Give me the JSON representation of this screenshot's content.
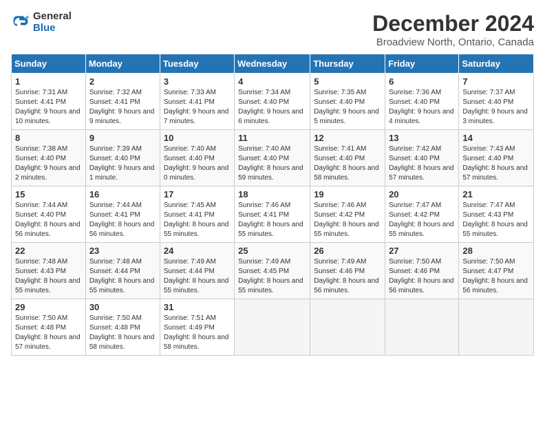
{
  "header": {
    "logo_general": "General",
    "logo_blue": "Blue",
    "title": "December 2024",
    "location": "Broadview North, Ontario, Canada"
  },
  "columns": [
    "Sunday",
    "Monday",
    "Tuesday",
    "Wednesday",
    "Thursday",
    "Friday",
    "Saturday"
  ],
  "weeks": [
    [
      {
        "day": "1",
        "info": "Sunrise: 7:31 AM\nSunset: 4:41 PM\nDaylight: 9 hours and 10 minutes."
      },
      {
        "day": "2",
        "info": "Sunrise: 7:32 AM\nSunset: 4:41 PM\nDaylight: 9 hours and 9 minutes."
      },
      {
        "day": "3",
        "info": "Sunrise: 7:33 AM\nSunset: 4:41 PM\nDaylight: 9 hours and 7 minutes."
      },
      {
        "day": "4",
        "info": "Sunrise: 7:34 AM\nSunset: 4:40 PM\nDaylight: 9 hours and 6 minutes."
      },
      {
        "day": "5",
        "info": "Sunrise: 7:35 AM\nSunset: 4:40 PM\nDaylight: 9 hours and 5 minutes."
      },
      {
        "day": "6",
        "info": "Sunrise: 7:36 AM\nSunset: 4:40 PM\nDaylight: 9 hours and 4 minutes."
      },
      {
        "day": "7",
        "info": "Sunrise: 7:37 AM\nSunset: 4:40 PM\nDaylight: 9 hours and 3 minutes."
      }
    ],
    [
      {
        "day": "8",
        "info": "Sunrise: 7:38 AM\nSunset: 4:40 PM\nDaylight: 9 hours and 2 minutes."
      },
      {
        "day": "9",
        "info": "Sunrise: 7:39 AM\nSunset: 4:40 PM\nDaylight: 9 hours and 1 minute."
      },
      {
        "day": "10",
        "info": "Sunrise: 7:40 AM\nSunset: 4:40 PM\nDaylight: 9 hours and 0 minutes."
      },
      {
        "day": "11",
        "info": "Sunrise: 7:40 AM\nSunset: 4:40 PM\nDaylight: 8 hours and 59 minutes."
      },
      {
        "day": "12",
        "info": "Sunrise: 7:41 AM\nSunset: 4:40 PM\nDaylight: 8 hours and 58 minutes."
      },
      {
        "day": "13",
        "info": "Sunrise: 7:42 AM\nSunset: 4:40 PM\nDaylight: 8 hours and 57 minutes."
      },
      {
        "day": "14",
        "info": "Sunrise: 7:43 AM\nSunset: 4:40 PM\nDaylight: 8 hours and 57 minutes."
      }
    ],
    [
      {
        "day": "15",
        "info": "Sunrise: 7:44 AM\nSunset: 4:40 PM\nDaylight: 8 hours and 56 minutes."
      },
      {
        "day": "16",
        "info": "Sunrise: 7:44 AM\nSunset: 4:41 PM\nDaylight: 8 hours and 56 minutes."
      },
      {
        "day": "17",
        "info": "Sunrise: 7:45 AM\nSunset: 4:41 PM\nDaylight: 8 hours and 55 minutes."
      },
      {
        "day": "18",
        "info": "Sunrise: 7:46 AM\nSunset: 4:41 PM\nDaylight: 8 hours and 55 minutes."
      },
      {
        "day": "19",
        "info": "Sunrise: 7:46 AM\nSunset: 4:42 PM\nDaylight: 8 hours and 55 minutes."
      },
      {
        "day": "20",
        "info": "Sunrise: 7:47 AM\nSunset: 4:42 PM\nDaylight: 8 hours and 55 minutes."
      },
      {
        "day": "21",
        "info": "Sunrise: 7:47 AM\nSunset: 4:43 PM\nDaylight: 8 hours and 55 minutes."
      }
    ],
    [
      {
        "day": "22",
        "info": "Sunrise: 7:48 AM\nSunset: 4:43 PM\nDaylight: 8 hours and 55 minutes."
      },
      {
        "day": "23",
        "info": "Sunrise: 7:48 AM\nSunset: 4:44 PM\nDaylight: 8 hours and 55 minutes."
      },
      {
        "day": "24",
        "info": "Sunrise: 7:49 AM\nSunset: 4:44 PM\nDaylight: 8 hours and 55 minutes."
      },
      {
        "day": "25",
        "info": "Sunrise: 7:49 AM\nSunset: 4:45 PM\nDaylight: 8 hours and 55 minutes."
      },
      {
        "day": "26",
        "info": "Sunrise: 7:49 AM\nSunset: 4:46 PM\nDaylight: 8 hours and 56 minutes."
      },
      {
        "day": "27",
        "info": "Sunrise: 7:50 AM\nSunset: 4:46 PM\nDaylight: 8 hours and 56 minutes."
      },
      {
        "day": "28",
        "info": "Sunrise: 7:50 AM\nSunset: 4:47 PM\nDaylight: 8 hours and 56 minutes."
      }
    ],
    [
      {
        "day": "29",
        "info": "Sunrise: 7:50 AM\nSunset: 4:48 PM\nDaylight: 8 hours and 57 minutes."
      },
      {
        "day": "30",
        "info": "Sunrise: 7:50 AM\nSunset: 4:48 PM\nDaylight: 8 hours and 58 minutes."
      },
      {
        "day": "31",
        "info": "Sunrise: 7:51 AM\nSunset: 4:49 PM\nDaylight: 8 hours and 58 minutes."
      },
      null,
      null,
      null,
      null
    ]
  ]
}
